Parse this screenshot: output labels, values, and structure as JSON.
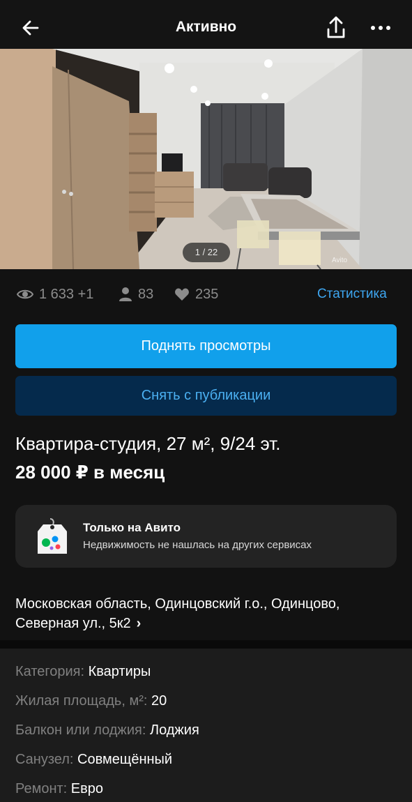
{
  "header": {
    "title": "Активно",
    "back_icon": "arrow-left-icon",
    "share_icon": "share-upload-icon",
    "more_icon": "more-dots-icon"
  },
  "gallery": {
    "counter": "1 / 22",
    "watermark": "Avito"
  },
  "stats": {
    "views": "1 633 +1",
    "contacts": "83",
    "favorites": "235",
    "statistics_link": "Статистика"
  },
  "actions": {
    "raise_views": "Поднять просмотры",
    "unpublish": "Снять с публикации"
  },
  "listing": {
    "title": "Квартира-студия, 27 м², 9/24 эт.",
    "price": "28 000 ₽ в месяц"
  },
  "promo": {
    "title": "Только на Авито",
    "subtitle": "Недвижимость не нашлась на других сервисах"
  },
  "address": {
    "line1": "Московская область, Одинцовский г.о., Одинцово,",
    "line2": "Северная ул., 5к2"
  },
  "details": [
    {
      "label": "Категория:",
      "value": "Квартиры"
    },
    {
      "label": "Жилая площадь, м²:",
      "value": "20"
    },
    {
      "label": "Балкон или лоджия:",
      "value": "Лоджия"
    },
    {
      "label": "Санузел:",
      "value": "Совмещённый"
    },
    {
      "label": "Ремонт:",
      "value": "Евро"
    }
  ],
  "colors": {
    "background": "#121212",
    "accent": "#11a0eb",
    "secondary_button": "#052a4c",
    "link": "#3ea6f0"
  }
}
